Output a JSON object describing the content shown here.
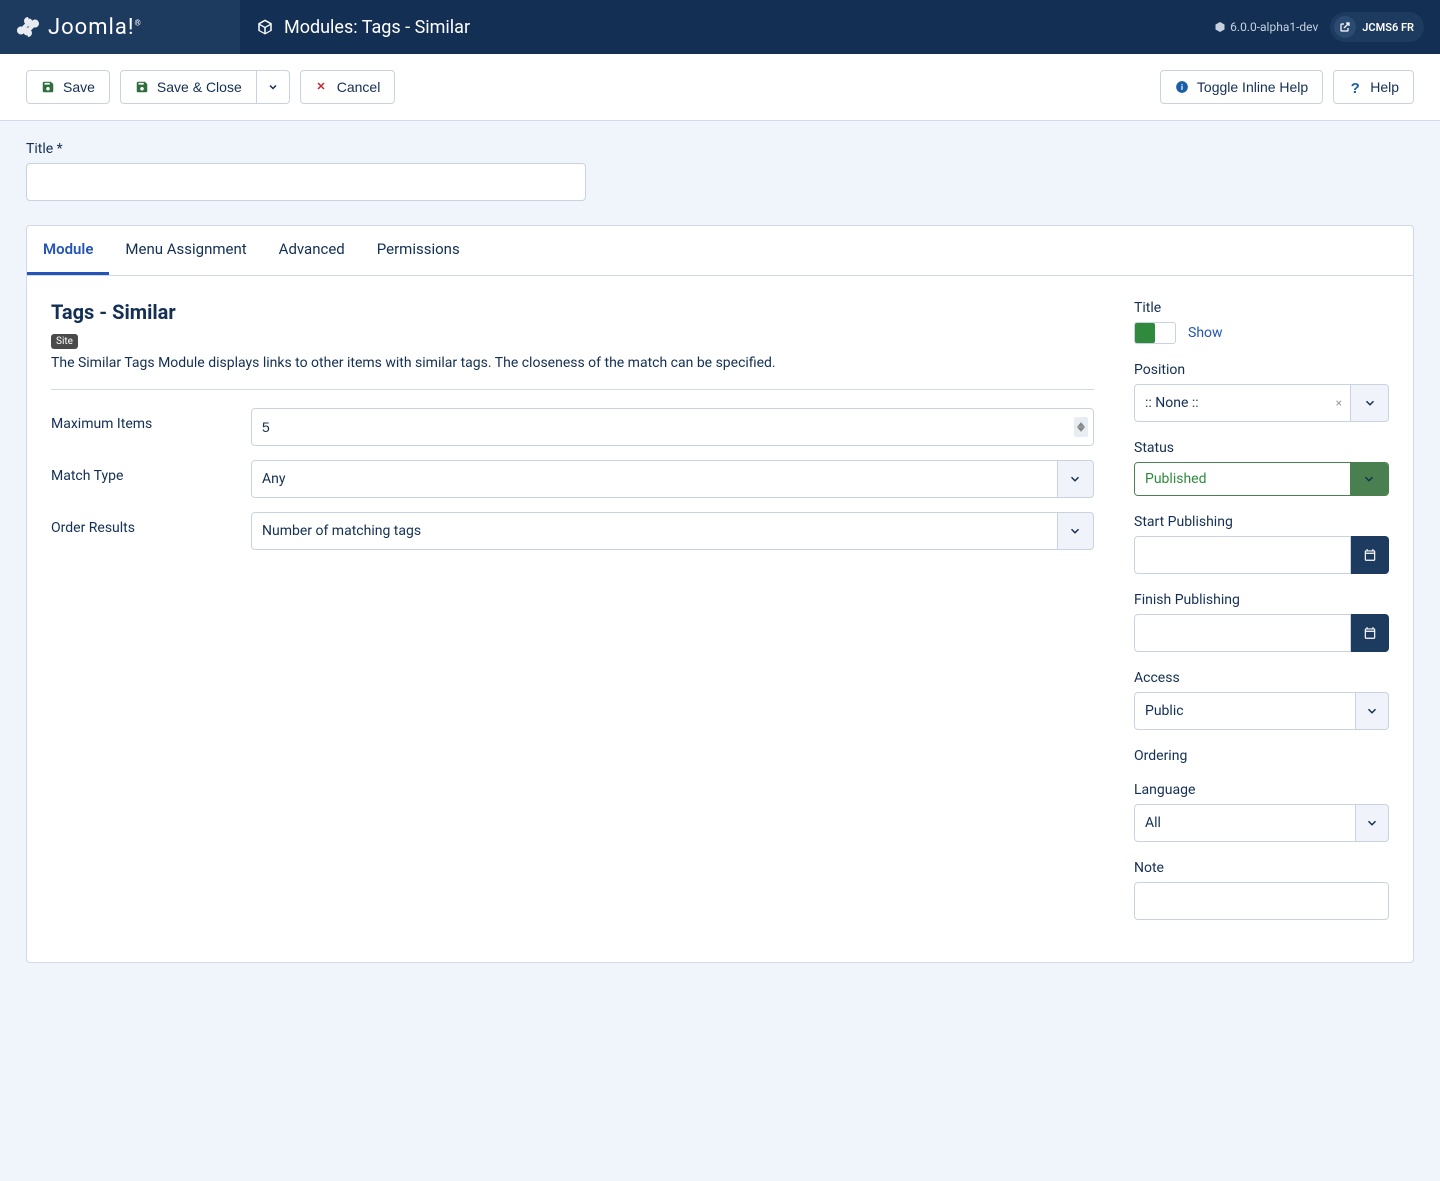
{
  "topbar": {
    "logo": "Joomla!",
    "page_title": "Modules: Tags - Similar",
    "version": "6.0.0-alpha1-dev",
    "user": "JCMS6 FR"
  },
  "toolbar": {
    "save": "Save",
    "save_close": "Save & Close",
    "cancel": "Cancel",
    "toggle_help": "Toggle Inline Help",
    "help": "Help"
  },
  "title_field": {
    "label": "Title *",
    "value": ""
  },
  "tabs": [
    "Module",
    "Menu Assignment",
    "Advanced",
    "Permissions"
  ],
  "module": {
    "heading": "Tags - Similar",
    "badge": "Site",
    "description": "The Similar Tags Module displays links to other items with similar tags. The closeness of the match can be specified.",
    "fields": {
      "max_items": {
        "label": "Maximum Items",
        "value": "5"
      },
      "match_type": {
        "label": "Match Type",
        "value": "Any"
      },
      "order_results": {
        "label": "Order Results",
        "value": "Number of matching tags"
      }
    }
  },
  "side": {
    "title": {
      "label": "Title",
      "toggle": "Show"
    },
    "position": {
      "label": "Position",
      "value": ":: None ::"
    },
    "status": {
      "label": "Status",
      "value": "Published"
    },
    "start_pub": {
      "label": "Start Publishing",
      "value": ""
    },
    "finish_pub": {
      "label": "Finish Publishing",
      "value": ""
    },
    "access": {
      "label": "Access",
      "value": "Public"
    },
    "ordering": {
      "label": "Ordering"
    },
    "language": {
      "label": "Language",
      "value": "All"
    },
    "note": {
      "label": "Note",
      "value": ""
    }
  }
}
